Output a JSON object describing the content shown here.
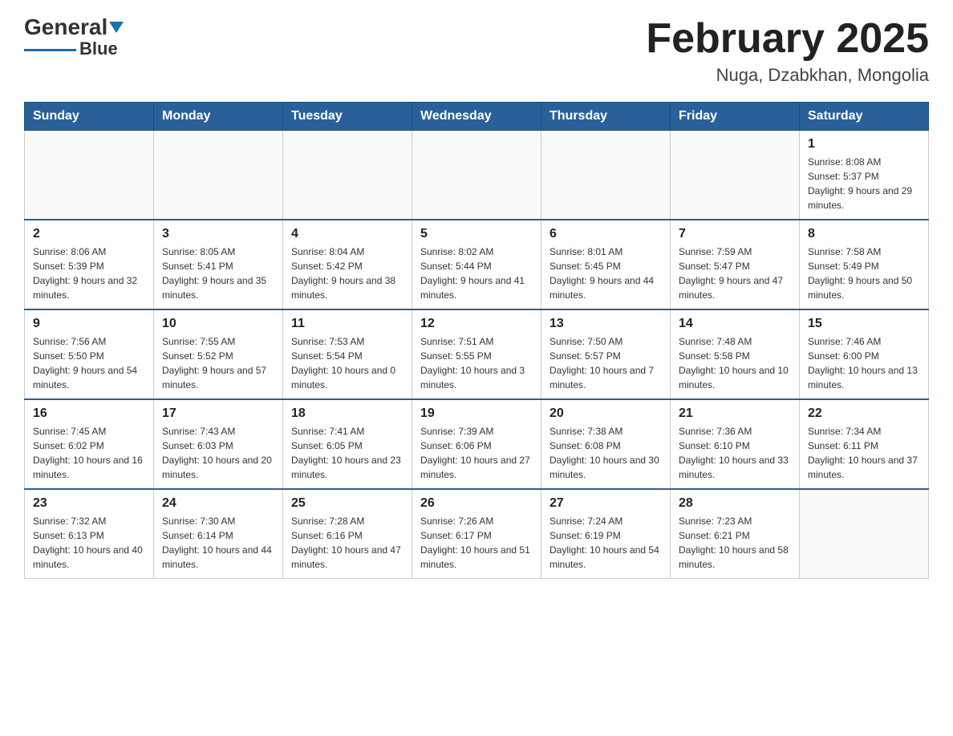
{
  "header": {
    "logo_general": "General",
    "logo_blue": "Blue",
    "title": "February 2025",
    "location": "Nuga, Dzabkhan, Mongolia"
  },
  "days_of_week": [
    "Sunday",
    "Monday",
    "Tuesday",
    "Wednesday",
    "Thursday",
    "Friday",
    "Saturday"
  ],
  "weeks": [
    {
      "days": [
        {
          "number": "",
          "info": ""
        },
        {
          "number": "",
          "info": ""
        },
        {
          "number": "",
          "info": ""
        },
        {
          "number": "",
          "info": ""
        },
        {
          "number": "",
          "info": ""
        },
        {
          "number": "",
          "info": ""
        },
        {
          "number": "1",
          "info": "Sunrise: 8:08 AM\nSunset: 5:37 PM\nDaylight: 9 hours and 29 minutes."
        }
      ]
    },
    {
      "days": [
        {
          "number": "2",
          "info": "Sunrise: 8:06 AM\nSunset: 5:39 PM\nDaylight: 9 hours and 32 minutes."
        },
        {
          "number": "3",
          "info": "Sunrise: 8:05 AM\nSunset: 5:41 PM\nDaylight: 9 hours and 35 minutes."
        },
        {
          "number": "4",
          "info": "Sunrise: 8:04 AM\nSunset: 5:42 PM\nDaylight: 9 hours and 38 minutes."
        },
        {
          "number": "5",
          "info": "Sunrise: 8:02 AM\nSunset: 5:44 PM\nDaylight: 9 hours and 41 minutes."
        },
        {
          "number": "6",
          "info": "Sunrise: 8:01 AM\nSunset: 5:45 PM\nDaylight: 9 hours and 44 minutes."
        },
        {
          "number": "7",
          "info": "Sunrise: 7:59 AM\nSunset: 5:47 PM\nDaylight: 9 hours and 47 minutes."
        },
        {
          "number": "8",
          "info": "Sunrise: 7:58 AM\nSunset: 5:49 PM\nDaylight: 9 hours and 50 minutes."
        }
      ]
    },
    {
      "days": [
        {
          "number": "9",
          "info": "Sunrise: 7:56 AM\nSunset: 5:50 PM\nDaylight: 9 hours and 54 minutes."
        },
        {
          "number": "10",
          "info": "Sunrise: 7:55 AM\nSunset: 5:52 PM\nDaylight: 9 hours and 57 minutes."
        },
        {
          "number": "11",
          "info": "Sunrise: 7:53 AM\nSunset: 5:54 PM\nDaylight: 10 hours and 0 minutes."
        },
        {
          "number": "12",
          "info": "Sunrise: 7:51 AM\nSunset: 5:55 PM\nDaylight: 10 hours and 3 minutes."
        },
        {
          "number": "13",
          "info": "Sunrise: 7:50 AM\nSunset: 5:57 PM\nDaylight: 10 hours and 7 minutes."
        },
        {
          "number": "14",
          "info": "Sunrise: 7:48 AM\nSunset: 5:58 PM\nDaylight: 10 hours and 10 minutes."
        },
        {
          "number": "15",
          "info": "Sunrise: 7:46 AM\nSunset: 6:00 PM\nDaylight: 10 hours and 13 minutes."
        }
      ]
    },
    {
      "days": [
        {
          "number": "16",
          "info": "Sunrise: 7:45 AM\nSunset: 6:02 PM\nDaylight: 10 hours and 16 minutes."
        },
        {
          "number": "17",
          "info": "Sunrise: 7:43 AM\nSunset: 6:03 PM\nDaylight: 10 hours and 20 minutes."
        },
        {
          "number": "18",
          "info": "Sunrise: 7:41 AM\nSunset: 6:05 PM\nDaylight: 10 hours and 23 minutes."
        },
        {
          "number": "19",
          "info": "Sunrise: 7:39 AM\nSunset: 6:06 PM\nDaylight: 10 hours and 27 minutes."
        },
        {
          "number": "20",
          "info": "Sunrise: 7:38 AM\nSunset: 6:08 PM\nDaylight: 10 hours and 30 minutes."
        },
        {
          "number": "21",
          "info": "Sunrise: 7:36 AM\nSunset: 6:10 PM\nDaylight: 10 hours and 33 minutes."
        },
        {
          "number": "22",
          "info": "Sunrise: 7:34 AM\nSunset: 6:11 PM\nDaylight: 10 hours and 37 minutes."
        }
      ]
    },
    {
      "days": [
        {
          "number": "23",
          "info": "Sunrise: 7:32 AM\nSunset: 6:13 PM\nDaylight: 10 hours and 40 minutes."
        },
        {
          "number": "24",
          "info": "Sunrise: 7:30 AM\nSunset: 6:14 PM\nDaylight: 10 hours and 44 minutes."
        },
        {
          "number": "25",
          "info": "Sunrise: 7:28 AM\nSunset: 6:16 PM\nDaylight: 10 hours and 47 minutes."
        },
        {
          "number": "26",
          "info": "Sunrise: 7:26 AM\nSunset: 6:17 PM\nDaylight: 10 hours and 51 minutes."
        },
        {
          "number": "27",
          "info": "Sunrise: 7:24 AM\nSunset: 6:19 PM\nDaylight: 10 hours and 54 minutes."
        },
        {
          "number": "28",
          "info": "Sunrise: 7:23 AM\nSunset: 6:21 PM\nDaylight: 10 hours and 58 minutes."
        },
        {
          "number": "",
          "info": ""
        }
      ]
    }
  ]
}
